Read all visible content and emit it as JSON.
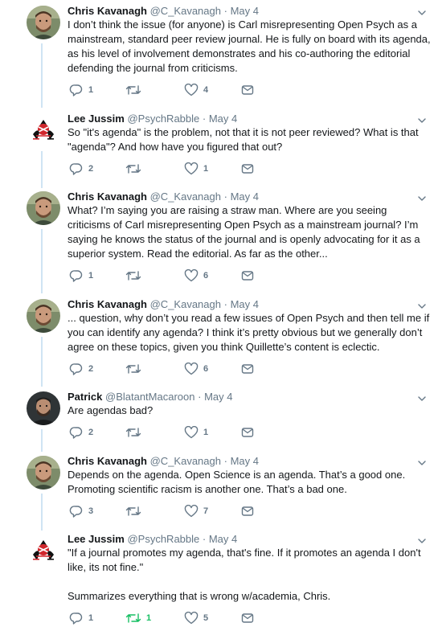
{
  "tweets": [
    {
      "name": "Chris Kavanagh",
      "handle": "@C_Kavanagh",
      "sep": "·",
      "date": "May 4",
      "avatar": "chris-photo",
      "text": "I don’t think the issue (for anyone) is Carl misrepresenting Open Psych as a mainstream, standard peer review journal. He is fully on board with its agenda, as his level of involvement demonstrates and his co-authoring the editorial defending the journal from criticisms.",
      "replies": "1",
      "retweets": "",
      "likes": "4"
    },
    {
      "name": "Lee Jussim",
      "handle": "@PsychRabble",
      "sep": "·",
      "date": "May 4",
      "avatar": "lee-logo",
      "text": "So \"it's agenda\" is the problem, not that it is not peer reviewed? What is that \"agenda\"? And how have you figured that out?",
      "replies": "2",
      "retweets": "",
      "likes": "1"
    },
    {
      "name": "Chris Kavanagh",
      "handle": "@C_Kavanagh",
      "sep": "·",
      "date": "May 4",
      "avatar": "chris-photo",
      "text": "What? I’m saying you are raising a straw man. Where are you seeing criticisms of Carl misrepresenting Open Psych as a mainstream journal? I’m saying he knows the status of the journal and is openly advocating for it as a superior system. Read the editorial. As far as the other...",
      "replies": "1",
      "retweets": "",
      "likes": "6"
    },
    {
      "name": "Chris Kavanagh",
      "handle": "@C_Kavanagh",
      "sep": "·",
      "date": "May 4",
      "avatar": "chris-photo",
      "text": "... question, why don’t you read a few issues of Open Psych and then tell me if you can identify any agenda? I think it’s pretty obvious but we generally don’t agree on these topics, given you think Quillette’s content is eclectic.",
      "replies": "2",
      "retweets": "",
      "likes": "6"
    },
    {
      "name": "Patrick",
      "handle": "@BlatantMacaroon",
      "sep": "·",
      "date": "May 4",
      "avatar": "patrick-photo",
      "text": "Are agendas bad?",
      "replies": "2",
      "retweets": "",
      "likes": "1"
    },
    {
      "name": "Chris Kavanagh",
      "handle": "@C_Kavanagh",
      "sep": "·",
      "date": "May 4",
      "avatar": "chris-photo",
      "text": "Depends on the agenda. Open Science is an agenda. That’s a good one. Promoting scientific racism is another one. That’s a bad one.",
      "replies": "3",
      "retweets": "",
      "likes": "7"
    },
    {
      "name": "Lee Jussim",
      "handle": "@PsychRabble",
      "sep": "·",
      "date": "May 4",
      "avatar": "lee-logo",
      "text": "\"If a journal promotes my agenda, that's fine.  If it promotes an agenda I don't like, its not fine.\"\n\nSummarizes everything that is wrong w/academia, Chris.",
      "replies": "1",
      "retweets": "1",
      "likes": "5",
      "retweeted": true
    }
  ],
  "icons": {
    "reply": "reply-icon",
    "retweet": "retweet-icon",
    "like": "heart-icon",
    "dm": "envelope-icon",
    "more": "chevron-down-icon"
  },
  "colors": {
    "icon": "#657786",
    "retweeted": "#17bf63",
    "thread": "#cfe4f3"
  }
}
